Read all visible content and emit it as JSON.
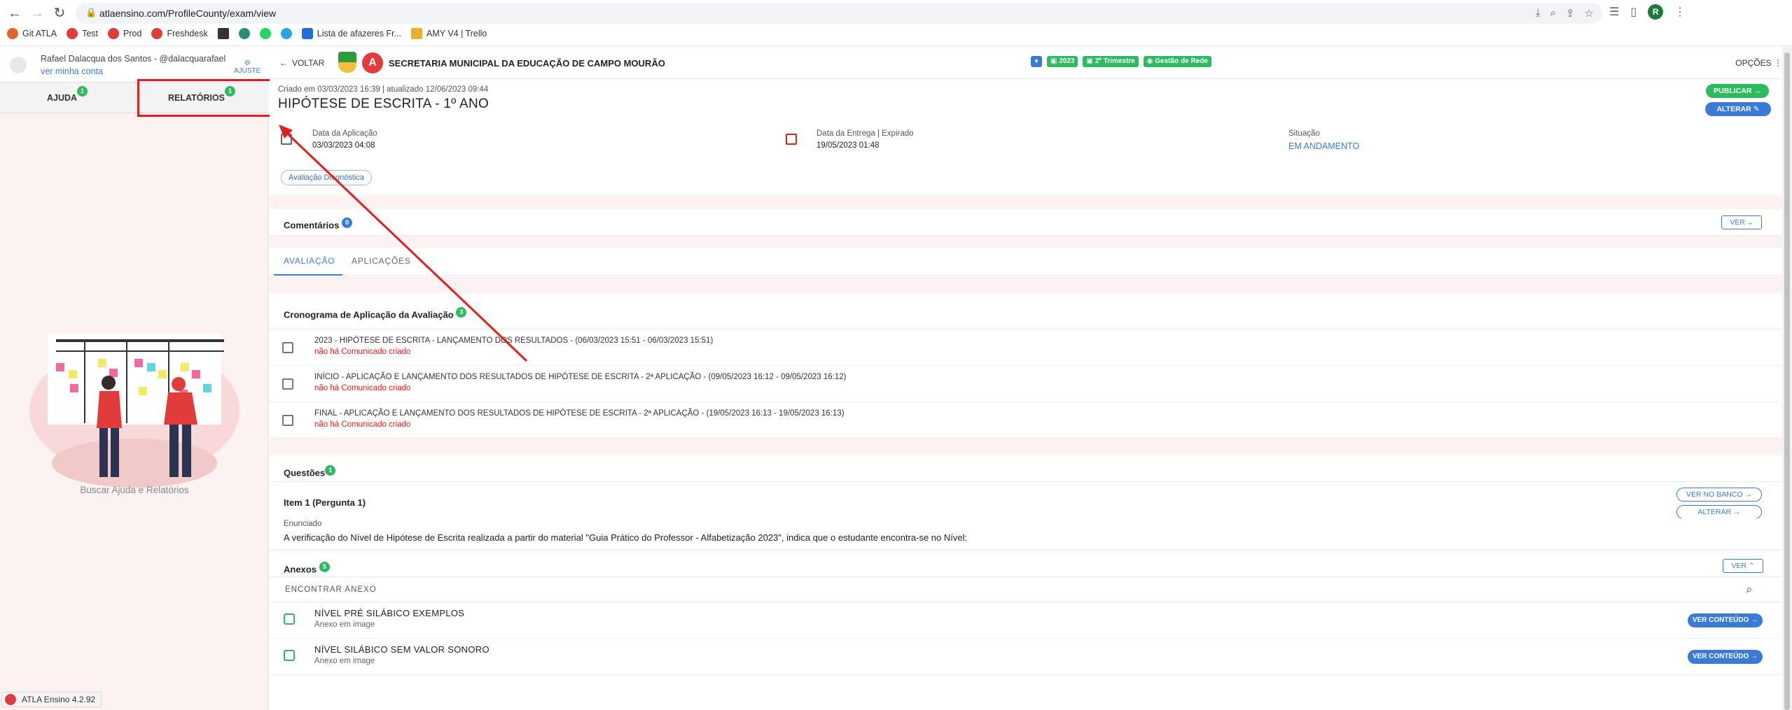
{
  "browser": {
    "url": "atlaensino.com/ProfileCounty/exam/view",
    "bookmarks": [
      "Git ATLA",
      "Test",
      "Prod",
      "Freshdesk",
      "Lista de afazeres Fr...",
      "AMY V4 | Trello"
    ],
    "profile_initial": "R"
  },
  "sidebar": {
    "user_name": "Rafael Dalacqua dos Santos - @dalacquarafael",
    "user_link": "ver minha conta",
    "adjust": "AJUSTE",
    "tabs": [
      {
        "label": "AJUDA",
        "badge": "1"
      },
      {
        "label": "RELATÓRIOS",
        "badge": "1"
      }
    ],
    "help_text": "Buscar Ajuda e Relatórios",
    "version": "ATLA Ensino 4.2.92"
  },
  "header": {
    "back": "VOLTAR",
    "org": "SECRETARIA MUNICIPAL DA EDUCAÇÃO DE CAMPO MOURÃO",
    "pills": [
      {
        "label": "",
        "color": "#3a7bd5"
      },
      {
        "label": "2023",
        "color": "#2dbb5f"
      },
      {
        "label": "2º Trimestre",
        "color": "#2dbb5f"
      },
      {
        "label": "Gestão de Rede",
        "color": "#2dbb5f"
      }
    ],
    "options": "OPÇÕES"
  },
  "exam": {
    "meta": "Criado em 03/03/2023 16:39 | atualizado 12/06/2023 09:44",
    "title": "HIPÓTESE DE ESCRITA - 1º ANO",
    "publish": "PUBLICAR",
    "alter": "ALTERAR",
    "application_date_label": "Data da Aplicação",
    "application_date": "03/03/2023 04:08",
    "delivery_date_label": "Data da Entrega | Expirado",
    "delivery_date": "19/05/2023 01:48",
    "status_label": "Situação",
    "status": "EM ANDAMENTO",
    "tag": "Avaliação Diagnóstica"
  },
  "comments": {
    "title": "Comentários",
    "badge": "0",
    "ver": "VER"
  },
  "main_tabs": [
    "AVALIAÇÃO",
    "APLICAÇÕES"
  ],
  "schedule": {
    "title": "Cronograma de Aplicação da Avaliação",
    "badge": "3",
    "items": [
      {
        "title": "2023 - HIPÓTESE DE ESCRITA - LANÇAMENTO DOS RESULTADOS - (06/03/2023 15:51 - 06/03/2023 15:51)",
        "sub": "não há Comunicado criado"
      },
      {
        "title": "INÍCIO - APLICAÇÃO E LANÇAMENTO DOS RESULTADOS DE HIPÓTESE DE ESCRITA - 2ª APLICAÇÃO - (09/05/2023 16:12 - 09/05/2023 16:12)",
        "sub": "não há Comunicado criado"
      },
      {
        "title": "FINAL - APLICAÇÃO E LANÇAMENTO DOS RESULTADOS DE HIPÓTESE DE ESCRITA - 2ª APLICAÇÃO - (19/05/2023 16:13 - 19/05/2023 16:13)",
        "sub": "não há Comunicado criado"
      }
    ]
  },
  "questions": {
    "title": "Questões",
    "badge": "1",
    "item_title": "Item 1 (Pergunta 1)",
    "ver_no_banco": "VER NO BANCO",
    "alterar": "ALTERAR",
    "enunciado_label": "Enunciado",
    "enunciado": "A verificação do Nível de Hipótese de Escrita realizada a partir do material \"Guia Prático do Professor - Alfabetização 2023\", indica que o estudante encontra-se no Nível:"
  },
  "attachments": {
    "title": "Anexos",
    "badge": "5",
    "ver": "VER",
    "find": "ENCONTRAR ANEXO",
    "items": [
      {
        "title": "NÍVEL PRÉ SILÁBICO EXEMPLOS",
        "sub": "Anexo em image",
        "button": "VER CONTEÚDO"
      },
      {
        "title": "NÍVEL SILÁBICO SEM VALOR SONORO",
        "sub": "Anexo em image",
        "button": "VER CONTEÚDO"
      }
    ]
  },
  "colors": {
    "accent": "#3a7bd5",
    "success": "#2dbb5f",
    "danger": "#e02020",
    "panel_bg": "#fdf1f1"
  }
}
